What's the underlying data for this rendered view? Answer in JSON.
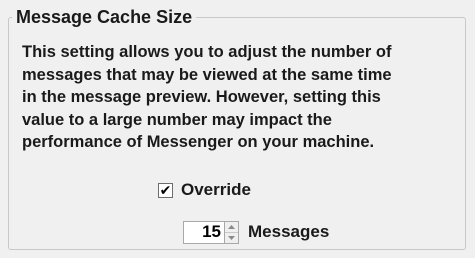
{
  "group": {
    "title": "Message Cache Size"
  },
  "description": {
    "lines": [
      "This setting allows you to adjust the number of",
      "messages that may be viewed at the same time",
      "in the message preview.  However, setting this",
      "value to a large number may impact the",
      "performance of Messenger on your machine."
    ]
  },
  "override": {
    "label": "Override",
    "checked": true,
    "check_mark": "✔"
  },
  "cache_size": {
    "value": "15",
    "unit_label": "Messages"
  },
  "icons": {
    "spin_up": "chevron-up-icon",
    "spin_down": "chevron-down-icon"
  },
  "colors": {
    "background": "#f0f0f0",
    "border": "#c8c8c8",
    "text": "#1a1a1a"
  }
}
